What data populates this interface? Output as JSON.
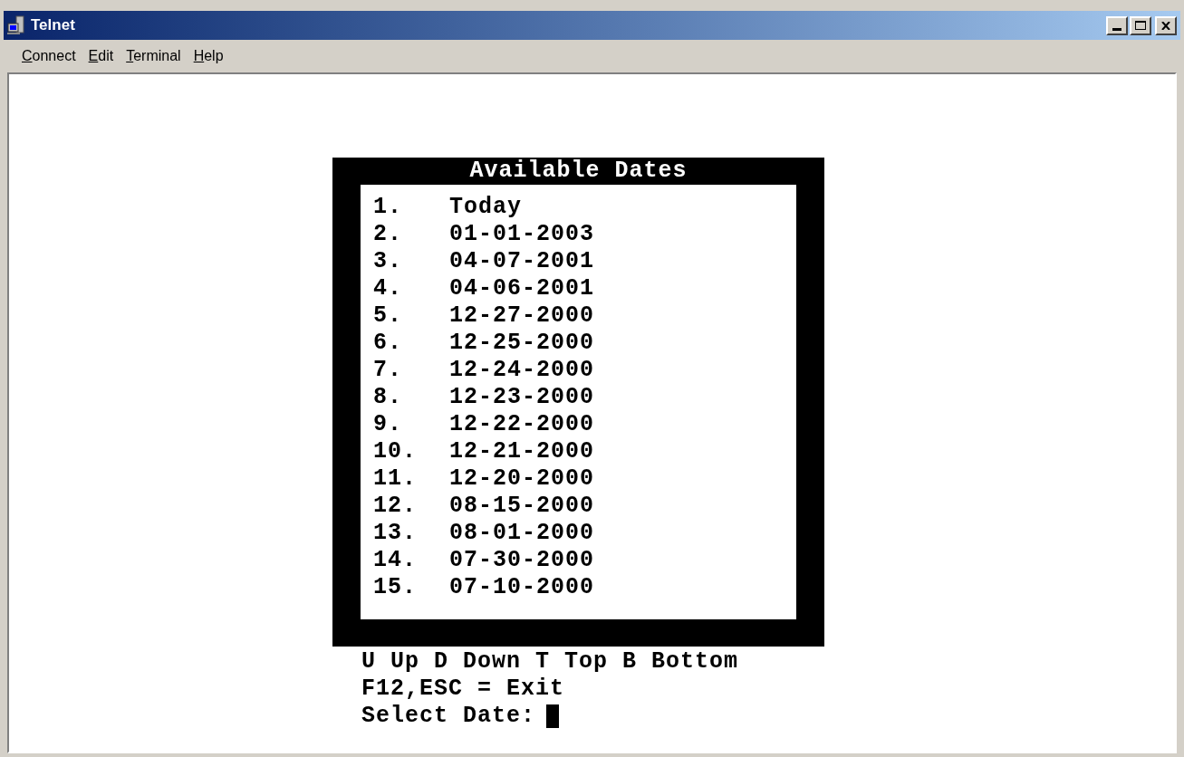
{
  "window": {
    "title": "Telnet"
  },
  "menu": [
    "Connect",
    "Edit",
    "Terminal",
    "Help"
  ],
  "terminal": {
    "panel_title": "Available Dates",
    "options": [
      {
        "number": "1.",
        "label": "Today"
      },
      {
        "number": "2.",
        "label": "01-01-2003"
      },
      {
        "number": "3.",
        "label": "04-07-2001"
      },
      {
        "number": "4.",
        "label": "04-06-2001"
      },
      {
        "number": "5.",
        "label": "12-27-2000"
      },
      {
        "number": "6.",
        "label": "12-25-2000"
      },
      {
        "number": "7.",
        "label": "12-24-2000"
      },
      {
        "number": "8.",
        "label": "12-23-2000"
      },
      {
        "number": "9.",
        "label": "12-22-2000"
      },
      {
        "number": "10.",
        "label": "12-21-2000"
      },
      {
        "number": "11.",
        "label": "12-20-2000"
      },
      {
        "number": "12.",
        "label": "08-15-2000"
      },
      {
        "number": "13.",
        "label": "08-01-2000"
      },
      {
        "number": "14.",
        "label": "07-30-2000"
      },
      {
        "number": "15.",
        "label": "07-10-2000"
      }
    ],
    "help_lines": [
      "U Up D Down T Top B Bottom",
      "F12,ESC = Exit"
    ],
    "prompt": "Select Date:"
  }
}
